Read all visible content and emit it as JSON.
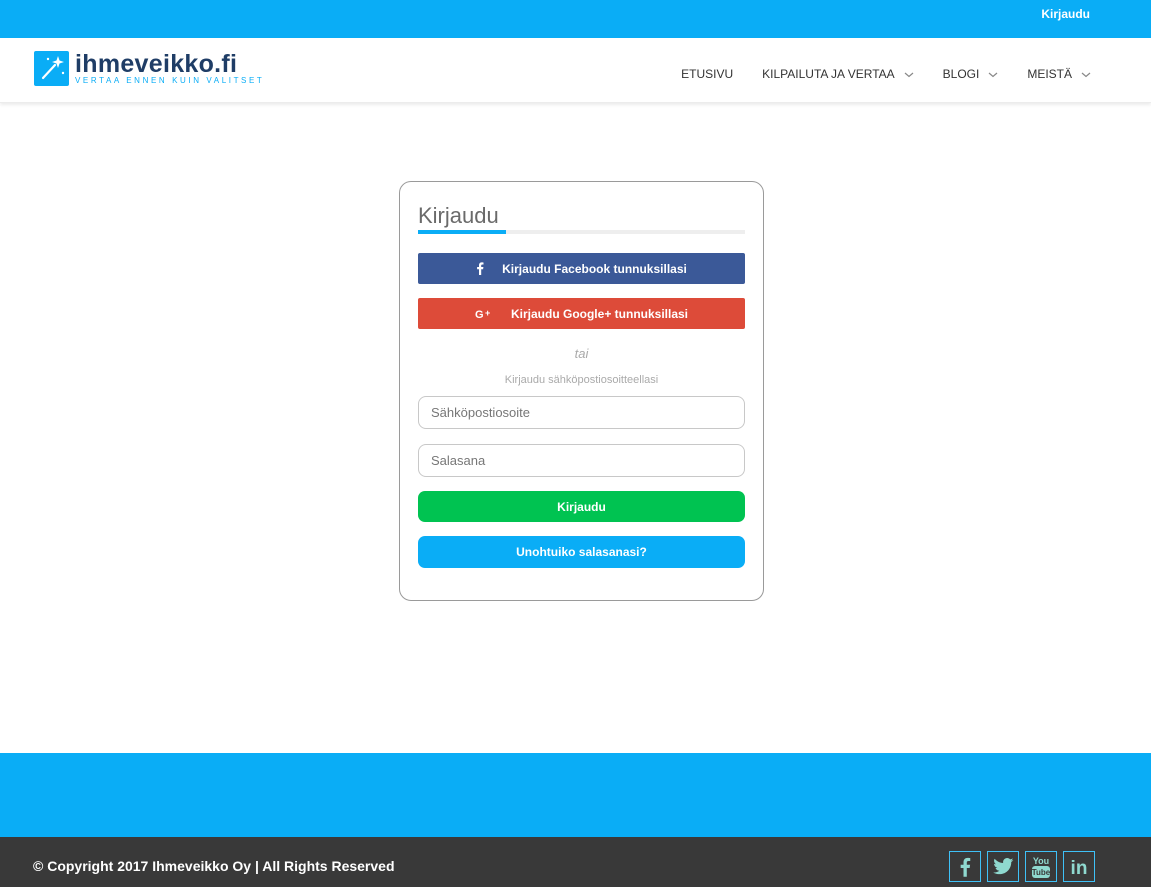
{
  "topbar": {
    "login_label": "Kirjaudu"
  },
  "brand": {
    "name": "ihmeveikko.fi",
    "tagline": "VERTAA ENNEN KUIN VALITSET",
    "logo_icon": "magic-wand-icon",
    "accent_color": "#0aadf6",
    "name_color": "#1f3d66"
  },
  "nav": {
    "items": [
      {
        "label": "ETUSIVU",
        "has_dropdown": false
      },
      {
        "label": "KILPAILUTA JA VERTAA",
        "has_dropdown": true
      },
      {
        "label": "BLOGI",
        "has_dropdown": true
      },
      {
        "label": "MEISTÄ",
        "has_dropdown": true
      }
    ]
  },
  "login_card": {
    "title": "Kirjaudu",
    "facebook_button": {
      "label": "Kirjaudu Facebook tunnuksillasi",
      "icon": "facebook-icon",
      "color": "#3b5998"
    },
    "google_button": {
      "label": "Kirjaudu Google+ tunnuksillasi",
      "icon": "google-plus-icon",
      "color": "#dd4b39"
    },
    "or_text": "tai",
    "email_heading": "Kirjaudu sähköpostiosoitteellasi",
    "email_field": {
      "placeholder": "Sähköpostiosoite",
      "value": ""
    },
    "password_field": {
      "placeholder": "Salasana",
      "value": ""
    },
    "login_button": {
      "label": "Kirjaudu",
      "color": "#00c351"
    },
    "forgot_button": {
      "label": "Unohtuiko salasanasi?",
      "color": "#0aadf6"
    }
  },
  "footer": {
    "copyright": "© Copyright 2017 Ihmeveikko Oy | All Rights Reserved",
    "socials": [
      "facebook-icon",
      "twitter-icon",
      "youtube-icon",
      "linkedin-icon"
    ],
    "youtube_text": [
      "You",
      "Tube"
    ],
    "linkedin_text": "in"
  }
}
